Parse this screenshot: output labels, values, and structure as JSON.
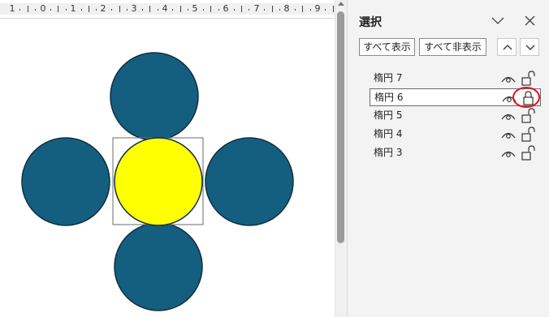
{
  "ruler": {
    "numbers": [
      "1",
      "1",
      "2",
      "3",
      "4",
      "5",
      "6",
      "7",
      "8",
      "9"
    ],
    "zero": "0"
  },
  "shapes": {
    "circle_color": "#145f80",
    "selected_color": "#ffff00",
    "outline_color": "#0f2f3f"
  },
  "pane": {
    "title": "選択",
    "show_all_label": "すべて表示",
    "hide_all_label": "すべて非表示",
    "objects": [
      {
        "name": "楕円 7",
        "visible": true,
        "locked": false,
        "selected": false
      },
      {
        "name": "楕円 6",
        "visible": true,
        "locked": true,
        "selected": true
      },
      {
        "name": "楕円 5",
        "visible": true,
        "locked": false,
        "selected": false
      },
      {
        "name": "楕円 4",
        "visible": true,
        "locked": false,
        "selected": false
      },
      {
        "name": "楕円 3",
        "visible": true,
        "locked": false,
        "selected": false
      }
    ]
  },
  "highlight_color": "#e0141c"
}
